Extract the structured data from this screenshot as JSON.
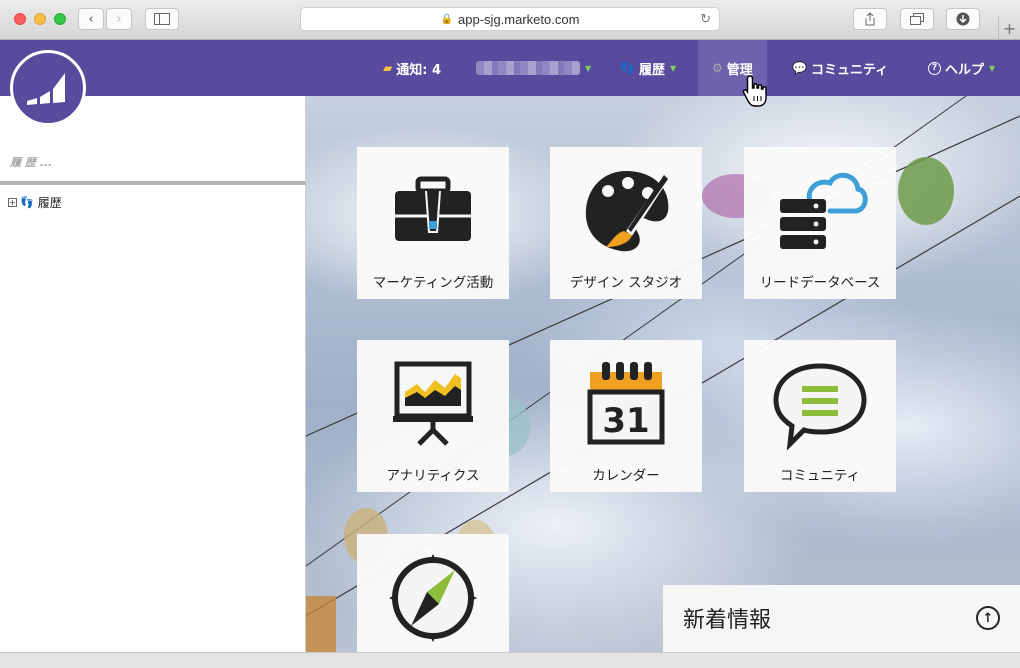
{
  "browser": {
    "url": "app-sjg.marketo.com"
  },
  "header": {
    "notifications": "通知: 4",
    "history": "履歴",
    "admin": "管理",
    "community": "コミュニティ",
    "help": "ヘルプ"
  },
  "sidebar": {
    "search_placeholder": "履 歴 ...",
    "tree_item": "履歴"
  },
  "tiles": [
    {
      "label": "マーケティング活動",
      "icon": "briefcase-icon"
    },
    {
      "label": "デザイン スタジオ",
      "icon": "palette-icon"
    },
    {
      "label": "リードデータベース",
      "icon": "database-cloud-icon"
    },
    {
      "label": "アナリティクス",
      "icon": "presentation-chart-icon"
    },
    {
      "label": "カレンダー",
      "icon": "calendar-icon"
    },
    {
      "label": "コミュニティ",
      "icon": "speech-bubble-icon"
    },
    {
      "label": "",
      "icon": "compass-icon"
    }
  ],
  "calendar_day": "31",
  "news": {
    "title": "新着情報"
  },
  "colors": {
    "brand": "#5a4a9e",
    "accent_orange": "#f0a020",
    "accent_blue": "#3e9fd9",
    "accent_green": "#8ebd3c"
  }
}
